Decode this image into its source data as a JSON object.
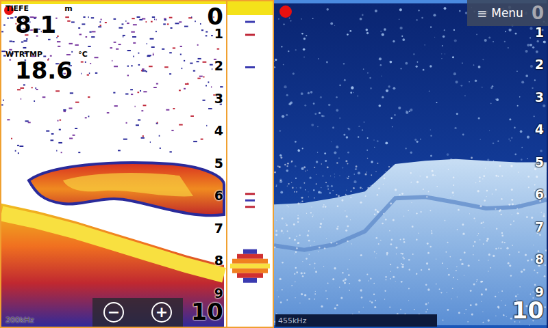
{
  "left_panel": {
    "recording": true,
    "depth": {
      "label": "TIEFE",
      "unit": "m",
      "value": "8.1"
    },
    "water_temp": {
      "label": "WTRTMP",
      "unit": "°C",
      "value": "18.6"
    },
    "scale": [
      "0",
      "1",
      "2",
      "3",
      "4",
      "5",
      "6",
      "7",
      "8",
      "9",
      "10"
    ],
    "zoom_buttons": [
      "−",
      "+"
    ],
    "frequency": "200kHz",
    "bottom_depths": [
      6.2,
      6.45,
      6.75,
      7.1,
      7.45,
      7.8,
      8.1
    ],
    "flasher": {
      "bottom_depth": 8.1
    }
  },
  "right_panel": {
    "recording": true,
    "menu_button": {
      "icon": "≡",
      "label": "Menu"
    },
    "scale": [
      "0",
      "1",
      "2",
      "3",
      "4",
      "5",
      "6",
      "7",
      "8",
      "9",
      "10"
    ],
    "frequency": "455kHz",
    "bottom_depths": [
      6.3,
      6.25,
      6.1,
      5.9,
      5.05,
      4.95,
      4.9,
      4.95,
      5.0,
      5.0
    ]
  }
}
